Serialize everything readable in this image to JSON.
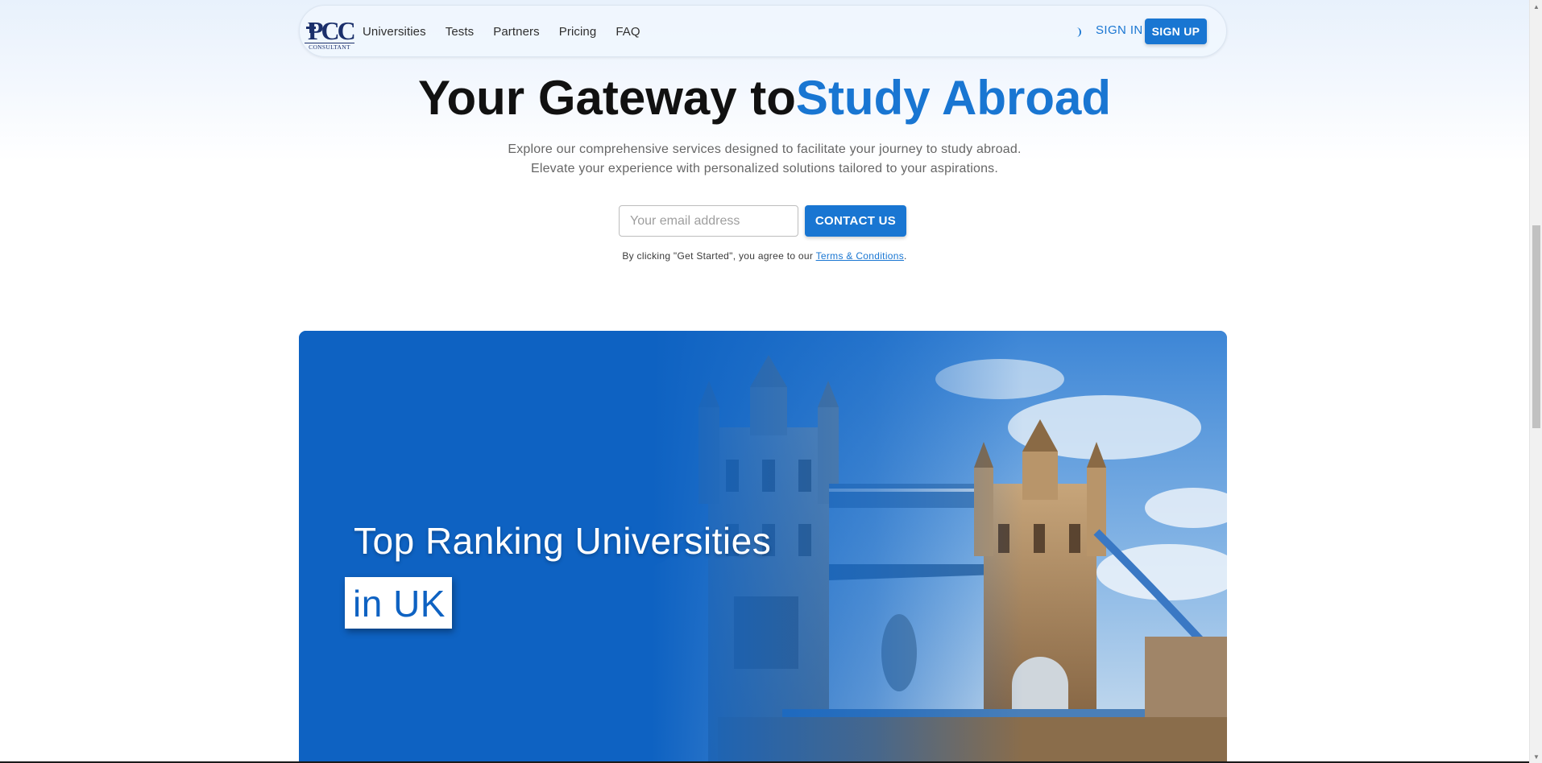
{
  "nav": {
    "logo_text": "PCC",
    "logo_subtext": "CONSULTANT",
    "links": [
      "Universities",
      "Tests",
      "Partners",
      "Pricing",
      "FAQ"
    ],
    "theme_icon": "moon-icon",
    "sign_in": "SIGN IN",
    "sign_up": "SIGN UP"
  },
  "hero": {
    "title_plain": "Your Gateway to",
    "title_accent": "Study Abroad",
    "subtitle_line1": "Explore our comprehensive services designed to facilitate your journey to study abroad.",
    "subtitle_line2": "Elevate your experience with personalized solutions tailored to your aspirations.",
    "email_placeholder": "Your email address",
    "email_value": "",
    "contact_button": "CONTACT US",
    "terms_prefix": "By clicking \"Get Started\", you agree to our ",
    "terms_link": "Terms & Conditions",
    "terms_suffix": "."
  },
  "banner": {
    "line1": "Top Ranking Universities",
    "line2": "in UK"
  },
  "colors": {
    "accent": "#1976d2",
    "banner_blue": "#0e62c2"
  }
}
